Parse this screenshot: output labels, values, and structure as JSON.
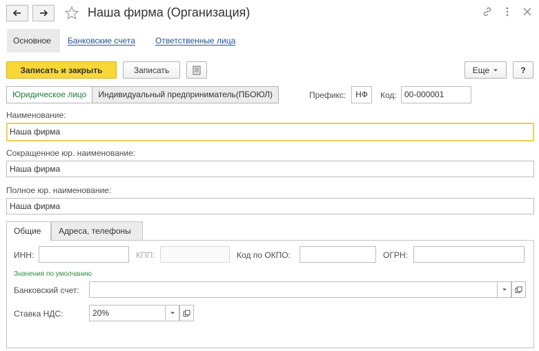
{
  "window": {
    "title": "Наша фирма (Организация)"
  },
  "form_tabs": [
    {
      "label": "Основное"
    },
    {
      "label": "Банковские счета"
    },
    {
      "label": "Ответственные лица"
    }
  ],
  "toolbar": {
    "save_close": "Записать и закрыть",
    "save": "Записать",
    "more": "Еще",
    "help": "?"
  },
  "type_toggle": {
    "legal": "Юридическое лицо",
    "individual": "Индивидуальный предприниматель(ПБОЮЛ)"
  },
  "prefix": {
    "label": "Префикс:",
    "value": "НФ"
  },
  "code": {
    "label": "Код:",
    "value": "00-000001"
  },
  "name": {
    "label": "Наименование:",
    "value": "Наша фирма"
  },
  "short_name": {
    "label": "Сокращенное юр. наименование:",
    "value": "Наша фирма"
  },
  "full_name": {
    "label": "Полное юр. наименование:",
    "value": "Наша фирма"
  },
  "page_tabs": [
    {
      "label": "Общие"
    },
    {
      "label": "Адреса, телефоны"
    }
  ],
  "general": {
    "inn_label": "ИНН:",
    "inn_value": "",
    "kpp_label": "КПП:",
    "kpp_value": "",
    "okpo_label": "Код по ОКПО:",
    "okpo_value": "",
    "ogrn_label": "ОГРН:",
    "ogrn_value": "",
    "defaults_header": "Значения по умолчанию",
    "bank_label": "Банковский счет:",
    "bank_value": "",
    "vat_label": "Ставка НДС:",
    "vat_value": "20%"
  },
  "colors": {
    "primary_button": "#f7d837",
    "toggle_active_text": "#1b7c3a",
    "link": "#2a4f8e",
    "focus_border": "#eac33c",
    "defaults_header": "#2e8b3e"
  },
  "icons": [
    "back-arrow-icon",
    "forward-arrow-icon",
    "star-icon",
    "link-icon",
    "more-vertical-icon",
    "close-icon",
    "list-icon",
    "chevron-down-icon",
    "open-window-icon"
  ]
}
